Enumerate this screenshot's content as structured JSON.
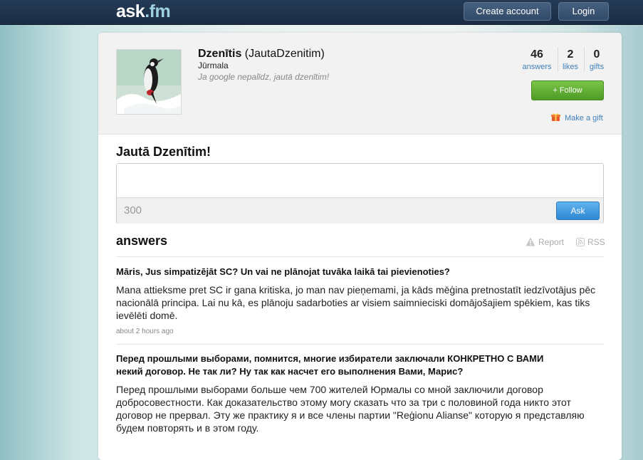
{
  "header": {
    "logo_main": "ask",
    "logo_fm": ".fm",
    "create_account": "Create account",
    "login": "Login"
  },
  "profile": {
    "display_name": "Dzenītis",
    "username": "(JautaDzenitim)",
    "location": "Jūrmala",
    "bio": "Ja google nepalīdz, jautā dzenītim!",
    "avatar_icon": "woodpecker-photo",
    "stats": [
      {
        "value": "46",
        "label": "answers"
      },
      {
        "value": "2",
        "label": "likes"
      },
      {
        "value": "0",
        "label": "gifts"
      }
    ],
    "follow_label": "+ Follow",
    "gift_label": "Make a gift"
  },
  "ask": {
    "title": "Jautā Dzenītim!",
    "counter": "300",
    "button": "Ask"
  },
  "answers": {
    "title": "answers",
    "report": "Report",
    "rss": "RSS",
    "items": [
      {
        "question": "Māris, Jus simpatizējāt SC? Un vai ne plānojat tuvāka laikā tai pievienoties?",
        "answer": "Mana attieksme pret SC ir gana kritiska, jo man nav pieņemami, ja kāds mēģina pretnostatīt iedzīvotājus pēc nacionālā principa. Lai nu kā, es plānoju sadarboties ar visiem saimnieciski domājošajiem spēkiem, kas tiks ievēlēti domē.",
        "time": "about 2 hours ago"
      },
      {
        "question": "Перед прошлыми выборами, помнится, многие избиратели заключали КОНКРЕТНО С ВАМИ некий договор. Не так ли? Ну так как насчет его выполнения Вами, Марис?",
        "answer": "Перед прошлыми выборами больше чем 700 жителей Юрмалы со мной заключили договор добросовестности. Как доказательство этому могу сказать что за три с половиной года никто этот договор не прервал. Эту же практику я и все члены партии \"Reģionu Alianse\" которую я представляю будем повторять и в этом году.",
        "time": ""
      }
    ]
  },
  "colors": {
    "topbar": "#1e324c",
    "link": "#3f7fb8",
    "follow": "#5fae33",
    "ask_button": "#3f98de"
  }
}
